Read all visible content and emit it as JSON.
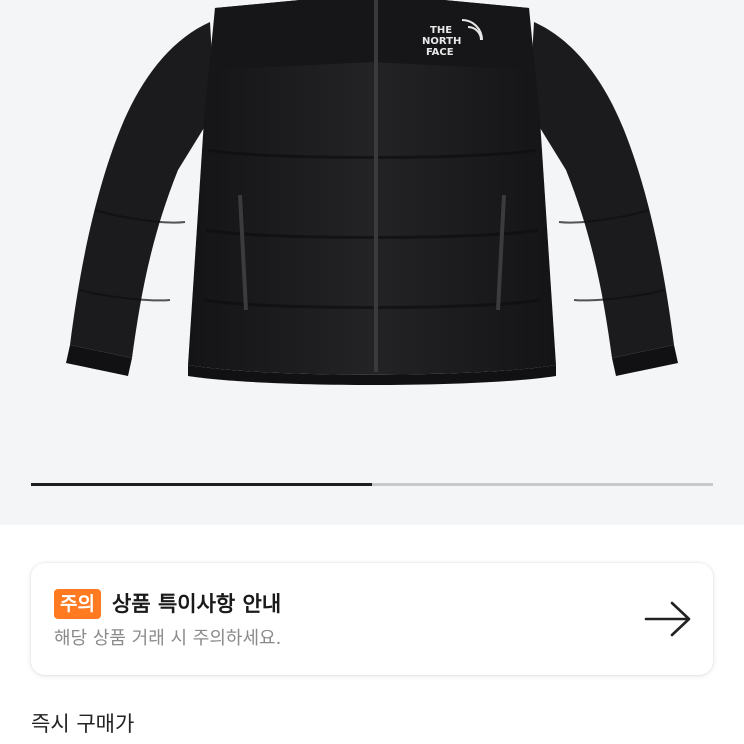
{
  "product": {
    "brand_logo_lines": [
      "THE",
      "NORTH",
      "FACE"
    ],
    "image_progress_fraction": 0.5
  },
  "notice": {
    "badge": "주의",
    "title": "상품 특이사항 안내",
    "subtitle": "해당 상품 거래 시 주의하세요."
  },
  "instant_price": {
    "label": "즉시 구매가"
  },
  "colors": {
    "accent": "#ff7a21",
    "jacket": "#1c1c1e",
    "hero_background": "#f4f5f7"
  },
  "icons": {
    "notice_arrow": "arrow-right-icon"
  }
}
